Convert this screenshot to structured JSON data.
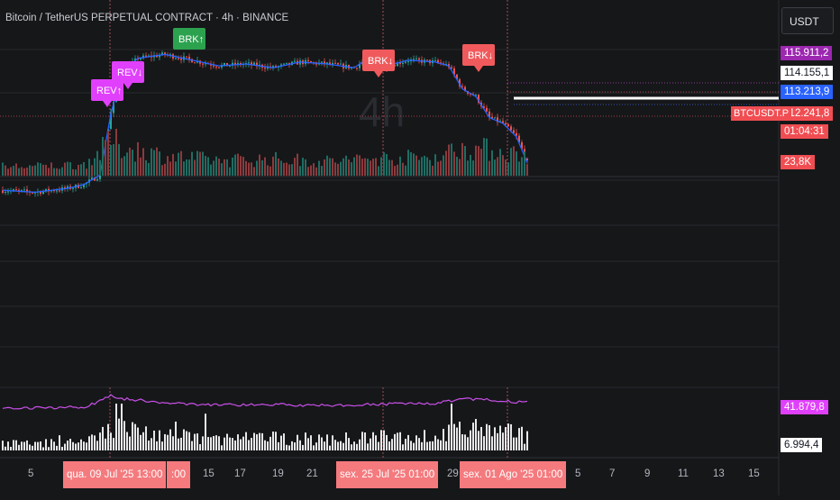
{
  "title": "Bitcoin / TetherUS PERPETUAL CONTRACT · 4h · BINANCE",
  "currency": "USDT",
  "watermark": "4h",
  "colors": {
    "background": "#161719",
    "up": "#26a69a",
    "down": "#ef5350",
    "ma": "#2962ff",
    "signal_rev": "#e040fb",
    "signal_brk_up": "#2ca24f",
    "signal_brk_down": "#f05a5c",
    "avg_line": "#c850e8"
  },
  "price_labels": [
    {
      "text": "115.911,2",
      "bg": "#9c27b0",
      "fg": "#ffffff",
      "value": 115911.2
    },
    {
      "text": "114.155,1",
      "bg": "#ffffff",
      "fg": "#131722",
      "value": 114155.1
    },
    {
      "text": "113.213,9",
      "bg": "#2962ff",
      "fg": "#ffffff",
      "value": 113213.9
    },
    {
      "text": "112.241,8",
      "bg": "#f04d52",
      "fg": "#ffffff",
      "value": 112241.8
    }
  ],
  "countdown": "01:04:31",
  "symbol_label": "BTCUSDT.P",
  "volume_label": "23,8K",
  "indicator_labels": [
    {
      "text": "41.879,8",
      "bg": "#e040fb",
      "fg": "#ffffff"
    },
    {
      "text": "6.994,4",
      "bg": "#ffffff",
      "fg": "#131722"
    }
  ],
  "signals": [
    {
      "text": "REV↑",
      "type": "rev"
    },
    {
      "text": "REV↓",
      "type": "rev"
    },
    {
      "text": "BRK↑",
      "type": "brk_up"
    },
    {
      "text": "BRK↓",
      "type": "brk_down"
    },
    {
      "text": "BRK↓",
      "type": "brk_down"
    }
  ],
  "time_axis": {
    "ticks": [
      "5",
      "15",
      "17",
      "19",
      "21",
      "29",
      "5",
      "7",
      "9",
      "11",
      "13",
      "15"
    ],
    "highlight_labels": [
      "qua. 09 Jul '25   13:00",
      "sex. 25 Jul '25   01:00",
      "sex. 01 Ago '25   01:00"
    ],
    "partial_label": ":00"
  },
  "chart_data": {
    "type": "candlestick",
    "timeframe": "4h",
    "ylim": [
      111800,
      119800
    ],
    "price_path": [
      [
        0,
        110800
      ],
      [
        12,
        110700
      ],
      [
        24,
        110900
      ],
      [
        30,
        111100
      ],
      [
        36,
        111600
      ],
      [
        40,
        114800
      ],
      [
        44,
        116900
      ],
      [
        50,
        117700
      ],
      [
        60,
        117900
      ],
      [
        70,
        117600
      ],
      [
        80,
        117300
      ],
      [
        90,
        117400
      ],
      [
        100,
        117200
      ],
      [
        110,
        117500
      ],
      [
        120,
        117400
      ],
      [
        130,
        117200
      ],
      [
        135,
        117700
      ],
      [
        142,
        117300
      ],
      [
        150,
        117600
      ],
      [
        160,
        117500
      ],
      [
        165,
        117300
      ],
      [
        170,
        116100
      ],
      [
        175,
        115700
      ],
      [
        180,
        114600
      ],
      [
        185,
        114300
      ],
      [
        190,
        113600
      ],
      [
        194,
        112242
      ]
    ],
    "volume_path": [
      [
        0,
        0.18
      ],
      [
        12,
        0.18
      ],
      [
        30,
        0.22
      ],
      [
        36,
        0.45
      ],
      [
        40,
        0.7
      ],
      [
        44,
        0.55
      ],
      [
        50,
        0.5
      ],
      [
        60,
        0.38
      ],
      [
        80,
        0.3
      ],
      [
        100,
        0.32
      ],
      [
        120,
        0.28
      ],
      [
        140,
        0.34
      ],
      [
        160,
        0.36
      ],
      [
        170,
        0.55
      ],
      [
        180,
        0.5
      ],
      [
        194,
        0.4
      ]
    ],
    "volume_last": "23,8K",
    "indicator": {
      "average_last": 41879.8,
      "current_last": 6994.4
    }
  }
}
